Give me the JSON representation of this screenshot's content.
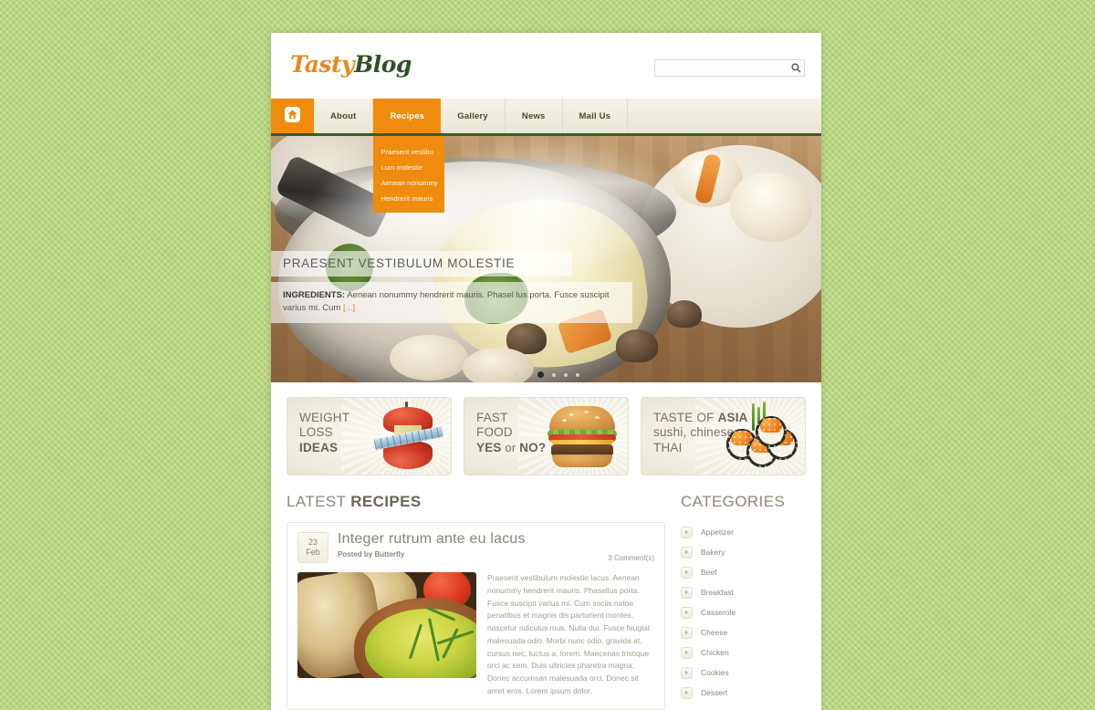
{
  "site": {
    "logo_primary": "Tasty",
    "logo_secondary": "Blog"
  },
  "search": {
    "value": "",
    "placeholder": "",
    "icon": "search-icon"
  },
  "nav": {
    "home_icon": "home-icon",
    "items": [
      {
        "label": "About",
        "active": false
      },
      {
        "label": "Recipes",
        "active": true
      },
      {
        "label": "Gallery",
        "active": false
      },
      {
        "label": "News",
        "active": false
      },
      {
        "label": "Mail Us",
        "active": false
      }
    ],
    "dropdown": {
      "parent": "Recipes",
      "items": [
        "Praesent vestibu",
        "Lum molestie",
        "Aenean nonummy",
        "Hendrerit mauris"
      ]
    }
  },
  "slider": {
    "caption_title": "PRAESENT VESTIBULUM MOLESTIE",
    "ingredients_label": "INGREDIENTS:",
    "ingredients_text": " Aenean nonummy hendrerit mauris. Phasel lus porta. Fusce suscipit varius mi. Cum ",
    "more_link": "[...]",
    "dots_total": 6,
    "dots_active_index": 2
  },
  "promos": [
    {
      "line1": "WEIGHT",
      "line2": "LOSS",
      "line3": "IDEAS",
      "art": "apple-core-with-tape-measure"
    },
    {
      "line1": "FAST",
      "line2": "FOOD",
      "line3_a": "YES",
      "line3_b": " or ",
      "line3_c": "NO?",
      "art": "hamburger"
    },
    {
      "line1_a": "TASTE OF ",
      "line1_b": "ASIA",
      "line2": "sushi, chinese",
      "line3": "THAI",
      "art": "sushi-rolls"
    }
  ],
  "latest": {
    "title_light": "LATEST ",
    "title_bold": "RECIPES",
    "post": {
      "day": "23",
      "month": "Feb",
      "title": "Integer rutrum ante eu lacus",
      "author_meta": "Posted by Butterfly",
      "comments": "3 Comment(s)",
      "thumbnail": "green-soup-bowl-with-bread",
      "excerpt": "Praesent vestibulum molestie lacus. Aenean nonummy hendrerit mauris. Phasellus porta. Fusce suscipit varius mi. Cum sociis natoe penatibus et magnis dis parturient montes, nascetur ridiculus mus. Nulla dui. Fusce feugiat malesuada odio. Morbi nunc odio, gravida at, cursus nec, luctus a, lorem. Maecenas tristique orci ac sem. Duis ultricies pharetra magna. Donec accumsan malesuada orci. Donec sit amet eros. Lorem ipsum dolor."
    }
  },
  "sidebar": {
    "title": "CATEGORIES",
    "categories": [
      "Appetizer",
      "Bakery",
      "Beef",
      "Breakfast",
      "Casserole",
      "Cheese",
      "Chicken",
      "Cookies",
      "Dessert"
    ]
  },
  "colors": {
    "accent_orange": "#ef8c0d",
    "dark_green": "#2f5227",
    "nav_cream": "#f1eee0",
    "page_bg_green": "#b9d67e"
  }
}
